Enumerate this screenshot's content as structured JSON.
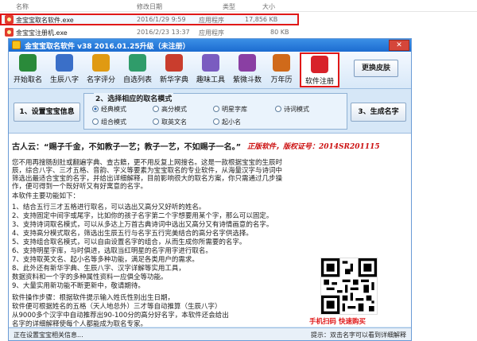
{
  "explorer": {
    "columns": [
      "名称",
      "修改日期",
      "类型",
      "大小"
    ],
    "files": [
      {
        "name": "金宝宝取名软件.exe",
        "date": "2016/1/29 9:59",
        "type": "应用程序",
        "size": "17,856 KB"
      },
      {
        "name": "金宝宝注册机.exe",
        "date": "2016/2/23 13:37",
        "type": "应用程序",
        "size": "80 KB"
      }
    ]
  },
  "window": {
    "title": "金宝宝取名软件 v38  2016.01.25升级（未注册）",
    "close": "✕",
    "toolbar": [
      {
        "label": "开始取名",
        "icon": "start-naming-icon",
        "color": "#2a8a3a"
      },
      {
        "label": "生辰八字",
        "icon": "bazi-icon",
        "color": "#3a6fc8"
      },
      {
        "label": "名字评分",
        "icon": "score-icon",
        "color": "#e09a12"
      },
      {
        "label": "自选列表",
        "icon": "list-icon",
        "color": "#2f9c6a"
      },
      {
        "label": "新华字典",
        "icon": "dictionary-icon",
        "color": "#c93d2d"
      },
      {
        "label": "趣味工具",
        "icon": "tools-icon",
        "color": "#7a5cc0"
      },
      {
        "label": "紫微斗数",
        "icon": "ziwei-icon",
        "color": "#8a3fa3"
      },
      {
        "label": "万年历",
        "icon": "calendar-icon",
        "color": "#d06a1a"
      },
      {
        "label": "软件注册",
        "icon": "register-icon",
        "color": "#d8222a"
      }
    ],
    "skin_button": "更换皮肤",
    "set_info_button": "1、设置宝宝信息",
    "generate_button": "3、生成名字",
    "mode_group": {
      "title": "2、选择相应的取名模式",
      "options": [
        "经典模式",
        "高分模式",
        "明星字库",
        "诗词模式",
        "组合模式",
        "取英文名",
        "起小名"
      ],
      "selected": "经典模式"
    },
    "content": {
      "quote": "古人云：“赐子千金，不如教子一艺；教子一艺，不如赐子一名。”",
      "cert": "正版软件，版权证号：2014SR201115",
      "intro": [
        "您不用再搜肠刮肚或翻遍字典、查古籍，更不用反复上网搜名。这是一款根据宝宝的生辰时",
        "辰，综合八字、三才五格、音韵、字义等要素为宝宝取名的专业软件，从海量汉字与诗词中",
        "筛选出最适合宝宝的名字，并给出详细解释，目前影响很大的取名方案，你只需通过几步操",
        "作，便可得到一个既好听又有好寓意的名字。"
      ],
      "functions_title": "本软件主要功能如下：",
      "functions": [
        "1、结合五行三才五格进行取名，可以选出又高分又好听的姓名。",
        "2、支持固定中间字或尾字，比如你的孩子名字第二个字想要用某个字，那么可以固定。",
        "3、支持诗词取名模式，可以从多达上万首古典诗词中选出又高分又有诗情画意的名字。",
        "4、支持高分模式取名，筛选出生辰五行与名字五行完美结合的高分名字供选择。",
        "5、支持组合取名模式，可以自由设置名字的组合，从而生成你所需要的名字。",
        "6、支持明星字库，与时俱进，选取当红明星的名字用字进行取名。",
        "7、支持取英文名、起小名等多种功能，满足各类用户的需求。",
        "8、此外还有新华字典、生辰八字、汉字详解等实用工具，",
        "   数据资料和一个字的多种属性资料一应俱全等功能。",
        "9、大量实用新功能不断更新中，敬请期待。"
      ],
      "steps_title": "软件操作步骤：根据软件提示输入姓氏性别出生日期，",
      "steps": [
        "软件便可根据姓名的五格（天人地总外）三才等自动推算（生辰八字）",
        "从9000多个汉字中自动推荐出90-100分的高分好名字，本软件还会给出",
        "名字的详细解释使每个人都能成为取名专家。"
      ],
      "qr_caption": "手机扫码  快速购买"
    },
    "status_left": "正在设置宝宝相关信息...",
    "status_right": "提示：双击名字可以看到详细解释"
  }
}
